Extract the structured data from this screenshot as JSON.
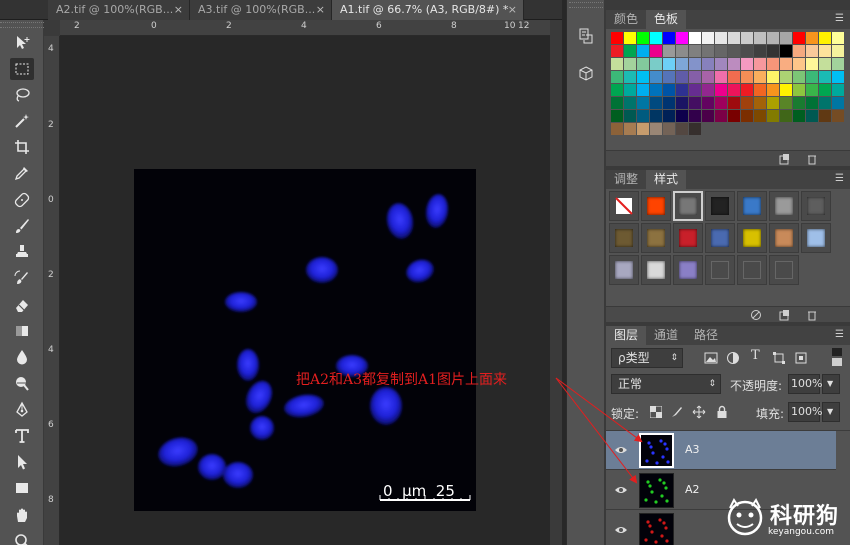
{
  "document_tabs": [
    {
      "label": "A2.tif @ 100%(RGB...",
      "close": "×",
      "active": false
    },
    {
      "label": "A3.tif @ 100%(RGB...",
      "close": "×",
      "active": false
    },
    {
      "label": "A1.tif @ 66.7% (A3, RGB/8#) *",
      "close": "×",
      "active": true
    }
  ],
  "ruler_top_ticks": [
    "2",
    "0",
    "2",
    "4",
    "6",
    "8",
    "10",
    "12"
  ],
  "ruler_left_ticks": [
    "4",
    "2",
    "0",
    "2",
    "4",
    "6",
    "8"
  ],
  "tools": [
    {
      "icon": "move-tool-icon",
      "active": false
    },
    {
      "icon": "marquee-tool-icon",
      "active": true
    },
    {
      "icon": "lasso-tool-icon",
      "active": false
    },
    {
      "icon": "magic-wand-tool-icon",
      "active": false
    },
    {
      "icon": "crop-tool-icon",
      "active": false
    },
    {
      "icon": "eyedropper-tool-icon",
      "active": false
    },
    {
      "icon": "healing-brush-tool-icon",
      "active": false
    },
    {
      "icon": "brush-tool-icon",
      "active": false
    },
    {
      "icon": "clone-stamp-tool-icon",
      "active": false
    },
    {
      "icon": "history-brush-tool-icon",
      "active": false
    },
    {
      "icon": "eraser-tool-icon",
      "active": false
    },
    {
      "icon": "gradient-tool-icon",
      "active": false
    },
    {
      "icon": "blur-tool-icon",
      "active": false
    },
    {
      "icon": "dodge-tool-icon",
      "active": false
    },
    {
      "icon": "pen-tool-icon",
      "active": false
    },
    {
      "icon": "type-tool-icon",
      "active": false
    },
    {
      "icon": "path-selection-tool-icon",
      "active": false
    },
    {
      "icon": "rectangle-tool-icon",
      "active": false
    },
    {
      "icon": "hand-tool-icon",
      "active": false
    },
    {
      "icon": "zoom-tool-icon",
      "active": false
    }
  ],
  "scale_bar": {
    "label": "0  μm  25"
  },
  "annotation": {
    "text": "把A2和A3都复制到A1图片上面来"
  },
  "swatches_panel": {
    "tabs": [
      "颜色",
      "色板"
    ],
    "active_tab": "色板",
    "colors": [
      "#ff0000",
      "#ffff00",
      "#00ff00",
      "#00ffff",
      "#0000ff",
      "#ff00ff",
      "#ffffff",
      "#f2f2f2",
      "#e6e6e6",
      "#d9d9d9",
      "#cccccc",
      "#bfbfbf",
      "#b3b3b3",
      "#a6a6a6",
      "#ff0000",
      "#f7941d",
      "#fff200",
      "#ffff99",
      "#ed1c24",
      "#00a651",
      "#00aeef",
      "#ec008c",
      "#999999",
      "#8c8c8c",
      "#808080",
      "#737373",
      "#666666",
      "#595959",
      "#4d4d4d",
      "#404040",
      "#333333",
      "#000000",
      "#f5a97f",
      "#f9c99a",
      "#fde39b",
      "#f6f39d",
      "#c4df9b",
      "#a3d39c",
      "#82ca9c",
      "#7accc8",
      "#6dcff6",
      "#7ea7d8",
      "#8393ca",
      "#8781bd",
      "#a187be",
      "#bc8cbf",
      "#f49ac1",
      "#f6989d",
      "#f69679",
      "#f9ad81",
      "#fdc689",
      "#fff799",
      "#c4df9b",
      "#a2d39c",
      "#3cb878",
      "#1cbbb4",
      "#00bff3",
      "#448ccb",
      "#5574b9",
      "#605ca8",
      "#855fa8",
      "#a763a8",
      "#f06eaa",
      "#f26c4f",
      "#f68e56",
      "#fbaf5d",
      "#fff568",
      "#acd373",
      "#7cc576",
      "#3bb878",
      "#1abbb4",
      "#00bff3",
      "#00a651",
      "#00a99d",
      "#00aeef",
      "#0072bc",
      "#0054a6",
      "#2e3192",
      "#662d91",
      "#92278f",
      "#ec008c",
      "#ed145b",
      "#ed1c24",
      "#f26522",
      "#f7941d",
      "#fff200",
      "#8dc63f",
      "#39b54a",
      "#00a651",
      "#00a99d",
      "#007236",
      "#00746b",
      "#0076a3",
      "#004a80",
      "#003471",
      "#1b1464",
      "#440e62",
      "#630460",
      "#9e005d",
      "#9e0b0f",
      "#a0410d",
      "#a36209",
      "#aba000",
      "#598527",
      "#197b30",
      "#007236",
      "#00746b",
      "#0076a3",
      "#005e20",
      "#005952",
      "#005b7f",
      "#003663",
      "#002157",
      "#0d004c",
      "#32004b",
      "#4b0049",
      "#7b0046",
      "#790000",
      "#7b2e00",
      "#7d4900",
      "#827b00",
      "#406618",
      "#005e20",
      "#005952",
      "#603913",
      "#754c24",
      "#8c6239",
      "#a67c52",
      "#c69c6d",
      "#998675",
      "#736357",
      "#534741",
      "#362f2d"
    ]
  },
  "styles_panel": {
    "tabs": [
      "调整",
      "样式"
    ],
    "active_tab": "样式",
    "styles": [
      {
        "icon": "no-style-icon"
      },
      {
        "color": "#ff4400"
      },
      {
        "color": "#777777"
      },
      {
        "color": "#222222"
      },
      {
        "color": "#3a79c8"
      },
      {
        "color": "#9a9a9a"
      },
      {
        "color": "#5e5e5e"
      },
      {
        "color": "#6d5a32"
      },
      {
        "color": "#8c7240"
      },
      {
        "color": "#c8202a"
      },
      {
        "color": "#4a6ab0"
      },
      {
        "color": "#d8c000"
      },
      {
        "color": "#c88a5a"
      },
      {
        "color": "#9fbfe8"
      },
      {
        "color": "#a8a8c0"
      },
      {
        "color": "#d9d9d9"
      },
      {
        "color": "#8a7fc6"
      },
      {
        "color": "#4a4a4a"
      },
      {
        "color": "#4a4a4a"
      },
      {
        "color": "#4a4a4a"
      }
    ]
  },
  "layers_panel": {
    "tabs": [
      "图层",
      "通道",
      "路径"
    ],
    "active_tab": "图层",
    "filter_label": "ρ类型",
    "blend_mode": "正常",
    "opacity_label": "不透明度:",
    "opacity_value": "100%",
    "lock_label": "锁定:",
    "fill_label": "填充:",
    "fill_value": "100%",
    "layers": [
      {
        "name": "A3",
        "color": "#2a34ff",
        "active": true
      },
      {
        "name": "A2",
        "color": "#22cc22",
        "active": false
      },
      {
        "name": "",
        "color": "#d01818",
        "active": false
      }
    ]
  },
  "watermark": {
    "brand": "科研狗",
    "site": "keyangou.com"
  }
}
